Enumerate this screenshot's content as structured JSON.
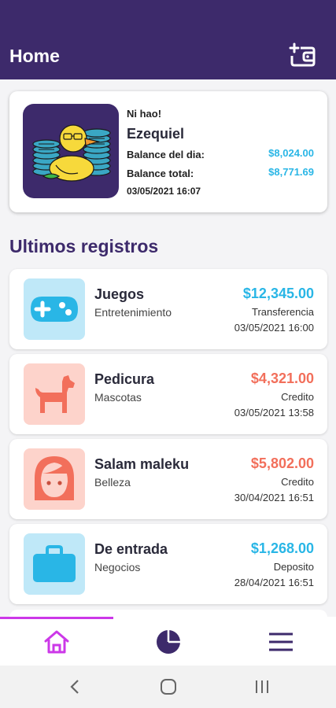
{
  "header": {
    "title": "Home",
    "wallet_icon": "add-wallet-icon"
  },
  "profile": {
    "greeting": "Ni hao!",
    "name": "Ezequiel",
    "daily_balance_label": "Balance del dia:",
    "daily_balance": "$8,024.00",
    "total_balance_label": "Balance total:",
    "total_balance": "$8,771.69",
    "datetime": "03/05/2021 16:07",
    "avatar_icon": "duck-avatar-icon"
  },
  "section_title": "Ultimos registros",
  "records": [
    {
      "name": "Juegos",
      "category": "Entretenimiento",
      "amount": "$12,345.00",
      "type": "Transferencia",
      "date": "03/05/2021 16:00",
      "icon": "gamepad-icon"
    },
    {
      "name": "Pedicura",
      "category": "Mascotas",
      "amount": "$4,321.00",
      "type": "Credito",
      "date": "03/05/2021 13:58",
      "icon": "dog-icon"
    },
    {
      "name": "Salam maleku",
      "category": "Belleza",
      "amount": "$5,802.00",
      "type": "Credito",
      "date": "30/04/2021 16:51",
      "icon": "face-icon"
    },
    {
      "name": "De entrada",
      "category": "Negocios",
      "amount": "$1,268.00",
      "type": "Deposito",
      "date": "28/04/2021 16:51",
      "icon": "briefcase-icon"
    }
  ],
  "colors": {
    "primary": "#3d2a6b",
    "income": "#29b6e6",
    "expense": "#f26f5b",
    "nav_active": "#cc38e8",
    "income_icon_bg": "#bfe8f8",
    "expense_icon_bg": "#fdd3cb"
  },
  "bottom_nav": [
    {
      "icon": "home-icon",
      "active": true
    },
    {
      "icon": "pie-chart-icon",
      "active": false
    },
    {
      "icon": "menu-icon",
      "active": false
    }
  ],
  "system_nav": [
    "back-icon",
    "home-circle-icon",
    "recents-icon"
  ]
}
